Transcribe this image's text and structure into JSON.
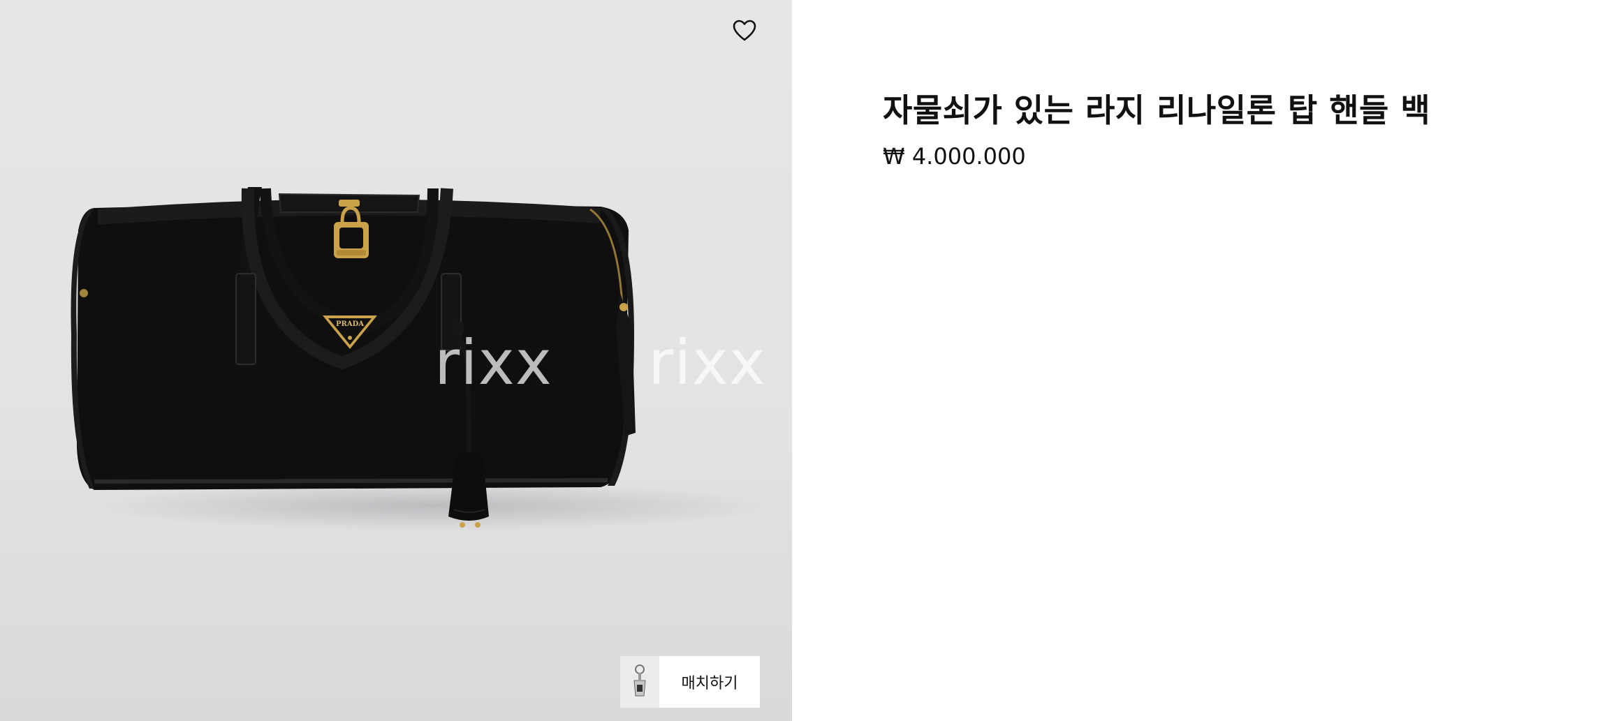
{
  "product": {
    "title": "자물쇠가 있는 라지 리나일론 탑 핸들 백",
    "price": "₩ 4.000.000",
    "brand_plaque": "PRADA",
    "image_alt": "black nylon duffle bag with padlock and key bell"
  },
  "overlay": {
    "watermark_1": "rixx",
    "watermark_2": "rixx"
  },
  "actions": {
    "wishlist_icon": "heart-outline-icon",
    "match_label": "매치하기"
  },
  "colors": {
    "image_background": "#e4e4e6",
    "bag": "#0e0e0f",
    "hardware_gold": "#c9a24a",
    "text": "#111111"
  }
}
